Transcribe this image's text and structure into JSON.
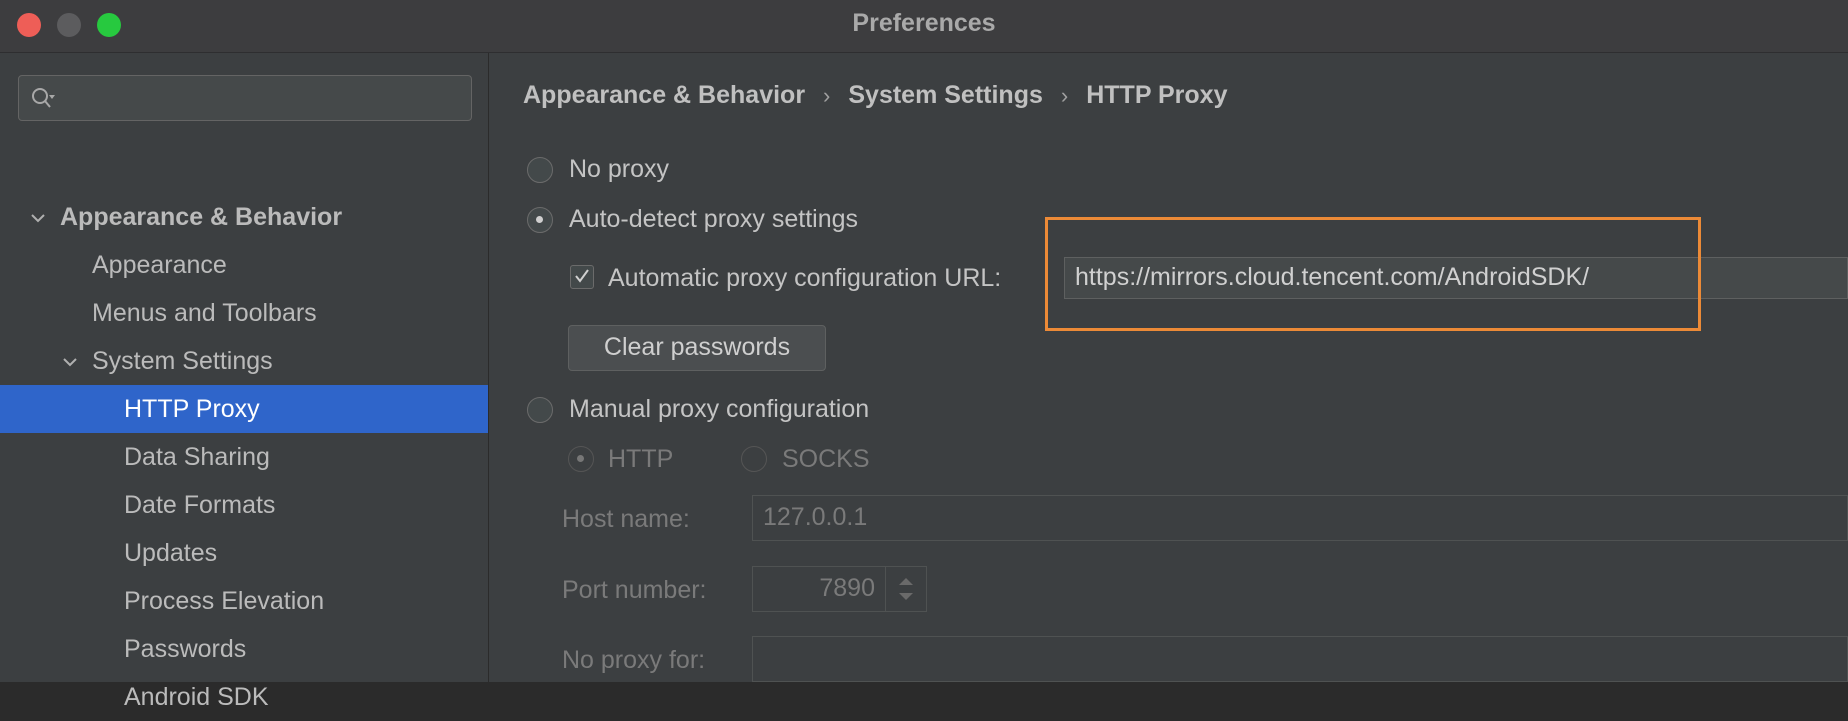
{
  "window": {
    "title": "Preferences"
  },
  "search": {
    "placeholder": ""
  },
  "sidebar": {
    "items": [
      {
        "label": "Appearance & Behavior"
      },
      {
        "label": "Appearance"
      },
      {
        "label": "Menus and Toolbars"
      },
      {
        "label": "System Settings"
      },
      {
        "label": "HTTP Proxy"
      },
      {
        "label": "Data Sharing"
      },
      {
        "label": "Date Formats"
      },
      {
        "label": "Updates"
      },
      {
        "label": "Process Elevation"
      },
      {
        "label": "Passwords"
      },
      {
        "label": "Android SDK"
      }
    ]
  },
  "breadcrumb": [
    "Appearance & Behavior",
    "System Settings",
    "HTTP Proxy"
  ],
  "proxy": {
    "no_proxy": "No proxy",
    "auto_detect": "Auto-detect proxy settings",
    "auto_config_url_label": "Automatic proxy configuration URL:",
    "auto_config_url_value": "https://mirrors.cloud.tencent.com/AndroidSDK/",
    "clear_passwords": "Clear passwords",
    "manual": "Manual proxy configuration",
    "http": "HTTP",
    "socks": "SOCKS",
    "host_label": "Host name:",
    "host_value": "127.0.0.1",
    "port_label": "Port number:",
    "port_value": "7890",
    "no_proxy_for_label": "No proxy for:",
    "no_proxy_for_value": ""
  },
  "colors": {
    "selection": "#2f65ca",
    "highlight": "#ec8a37"
  }
}
